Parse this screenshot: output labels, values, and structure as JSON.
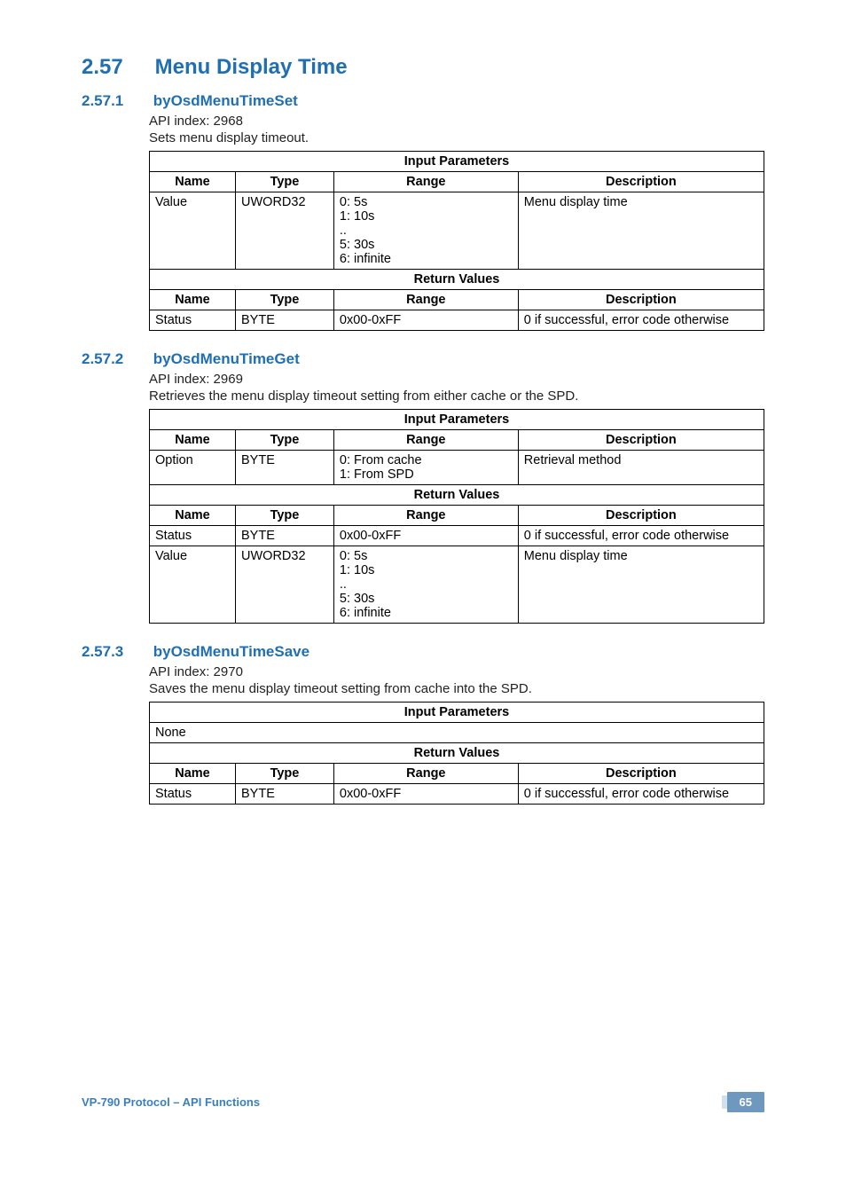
{
  "section": {
    "number": "2.57",
    "title": "Menu Display Time"
  },
  "subsections": [
    {
      "number": "2.57.1",
      "title": "byOsdMenuTimeSet",
      "api_index_label": "API index: 2968",
      "description": "Sets menu display timeout.",
      "table": {
        "input_header": "Input Parameters",
        "return_header": "Return Values",
        "cols": [
          "Name",
          "Type",
          "Range",
          "Description"
        ],
        "input_rows": [
          {
            "name": "Value",
            "type": "UWORD32",
            "range": [
              "0: 5s",
              "1: 10s",
              "..",
              "5: 30s",
              "6: infinite"
            ],
            "description": "Menu display time"
          }
        ],
        "return_rows": [
          {
            "name": "Status",
            "type": "BYTE",
            "range": [
              "0x00-0xFF"
            ],
            "description": "0 if successful, error code otherwise"
          }
        ]
      }
    },
    {
      "number": "2.57.2",
      "title": "byOsdMenuTimeGet",
      "api_index_label": "API index: 2969",
      "description": "Retrieves the menu display timeout setting from either cache or the SPD.",
      "table": {
        "input_header": "Input Parameters",
        "return_header": "Return Values",
        "cols": [
          "Name",
          "Type",
          "Range",
          "Description"
        ],
        "input_rows": [
          {
            "name": "Option",
            "type": "BYTE",
            "range": [
              "0: From cache",
              "1: From SPD"
            ],
            "description": "Retrieval method"
          }
        ],
        "return_rows": [
          {
            "name": "Status",
            "type": "BYTE",
            "range": [
              "0x00-0xFF"
            ],
            "description": "0 if successful, error code otherwise"
          },
          {
            "name": "Value",
            "type": "UWORD32",
            "range": [
              "0: 5s",
              "1: 10s",
              "..",
              "5: 30s",
              "6: infinite"
            ],
            "description": "Menu display time"
          }
        ]
      }
    },
    {
      "number": "2.57.3",
      "title": "byOsdMenuTimeSave",
      "api_index_label": "API index: 2970",
      "description": "Saves the menu display timeout setting from cache into the SPD.",
      "table": {
        "input_header": "Input Parameters",
        "return_header": "Return Values",
        "cols": [
          "Name",
          "Type",
          "Range",
          "Description"
        ],
        "input_none": "None",
        "input_rows": [],
        "return_rows": [
          {
            "name": "Status",
            "type": "BYTE",
            "range": [
              "0x00-0xFF"
            ],
            "description": "0 if successful, error code otherwise"
          }
        ]
      }
    }
  ],
  "footer": {
    "left": "VP-790 Protocol –  API Functions",
    "page": "65"
  }
}
